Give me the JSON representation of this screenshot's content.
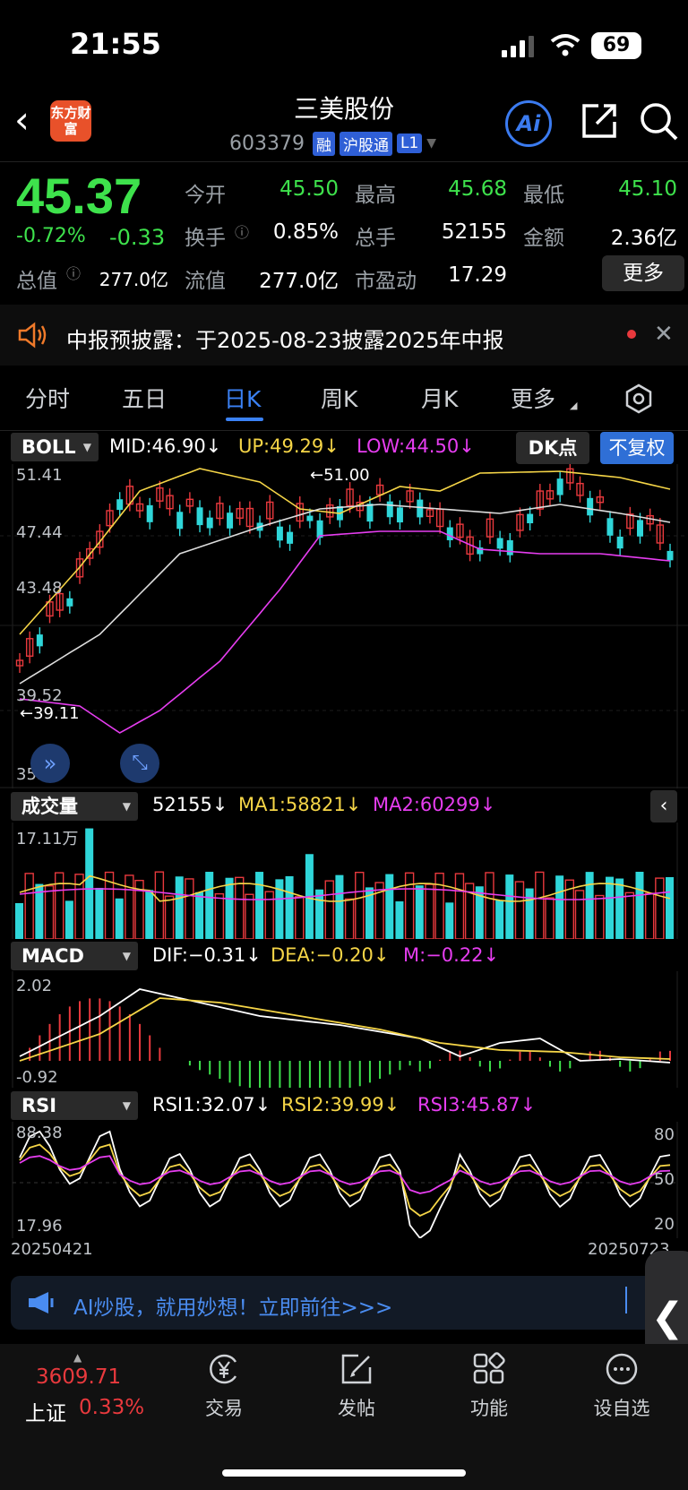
{
  "status": {
    "time": "21:55",
    "battery": "69"
  },
  "header": {
    "logo_text": "东方财富",
    "name": "三美股份",
    "code": "603379",
    "tags": [
      "融",
      "沪股通",
      "L1"
    ]
  },
  "quote": {
    "price": "45.37",
    "pct": "-0.72%",
    "chg": "-0.33",
    "rows": [
      [
        {
          "label": "今开",
          "value": "45.50"
        },
        {
          "label": "最高",
          "value": "45.68"
        },
        {
          "label": "最低",
          "value": "45.10"
        }
      ],
      [
        {
          "label": "换手",
          "value": "0.85%"
        },
        {
          "label": "总手",
          "value": "52155"
        },
        {
          "label": "金额",
          "value": "2.36亿"
        }
      ],
      [
        {
          "label": "总值",
          "value": "277.0亿"
        },
        {
          "label": "流值",
          "value": "277.0亿"
        },
        {
          "label": "市盈动",
          "value": "17.29"
        }
      ]
    ],
    "more": "更多"
  },
  "notice": {
    "text": "中报预披露：于2025-08-23披露2025年中报"
  },
  "tabs": [
    "分时",
    "五日",
    "日K",
    "周K",
    "月K",
    "更多"
  ],
  "boll": {
    "name": "BOLL",
    "mid": "MID:46.90↓",
    "up": "UP:49.29↓",
    "low": "LOW:44.50↓",
    "dk": "DK点",
    "fq": "不复权",
    "axis": [
      "51.41",
      "47.44",
      "43.48",
      "39.52",
      "35.55"
    ],
    "hi_mark": "←51.00",
    "lo_mark": "←39.11"
  },
  "volume": {
    "name": "成交量",
    "val": "52155↓",
    "ma1": "MA1:58821↓",
    "ma2": "MA2:60299↓",
    "axis_top": "17.11万"
  },
  "macd": {
    "name": "MACD",
    "dif": "DIF:−0.31↓",
    "dea": "DEA:−0.20↓",
    "m": "M:−0.22↓",
    "axis": [
      "2.02",
      "-0.92"
    ]
  },
  "rsi": {
    "name": "RSI",
    "r1": "RSI1:32.07↓",
    "r2": "RSI2:39.99↓",
    "r3": "RSI3:45.87↓",
    "axis": [
      "88.38",
      "17.96"
    ],
    "right_axis": [
      "80",
      "50",
      "20"
    ]
  },
  "dates": {
    "start": "20250421",
    "end": "20250723"
  },
  "ad": {
    "text": "AI炒股，就用妙想！立即前往>>>"
  },
  "bottom": {
    "index_value": "3609.71",
    "index_name": "上证",
    "index_pct": "0.33%",
    "nav": [
      {
        "label": "交易",
        "icon": "yen-icon"
      },
      {
        "label": "发帖",
        "icon": "edit-icon"
      },
      {
        "label": "功能",
        "icon": "grid-icon"
      },
      {
        "label": "设自选",
        "icon": "more-icon"
      }
    ]
  },
  "colors": {
    "up": "#e8393d",
    "down": "#2fd6d9",
    "accent": "#3b82f6",
    "price_down": "#3ee24c"
  }
}
